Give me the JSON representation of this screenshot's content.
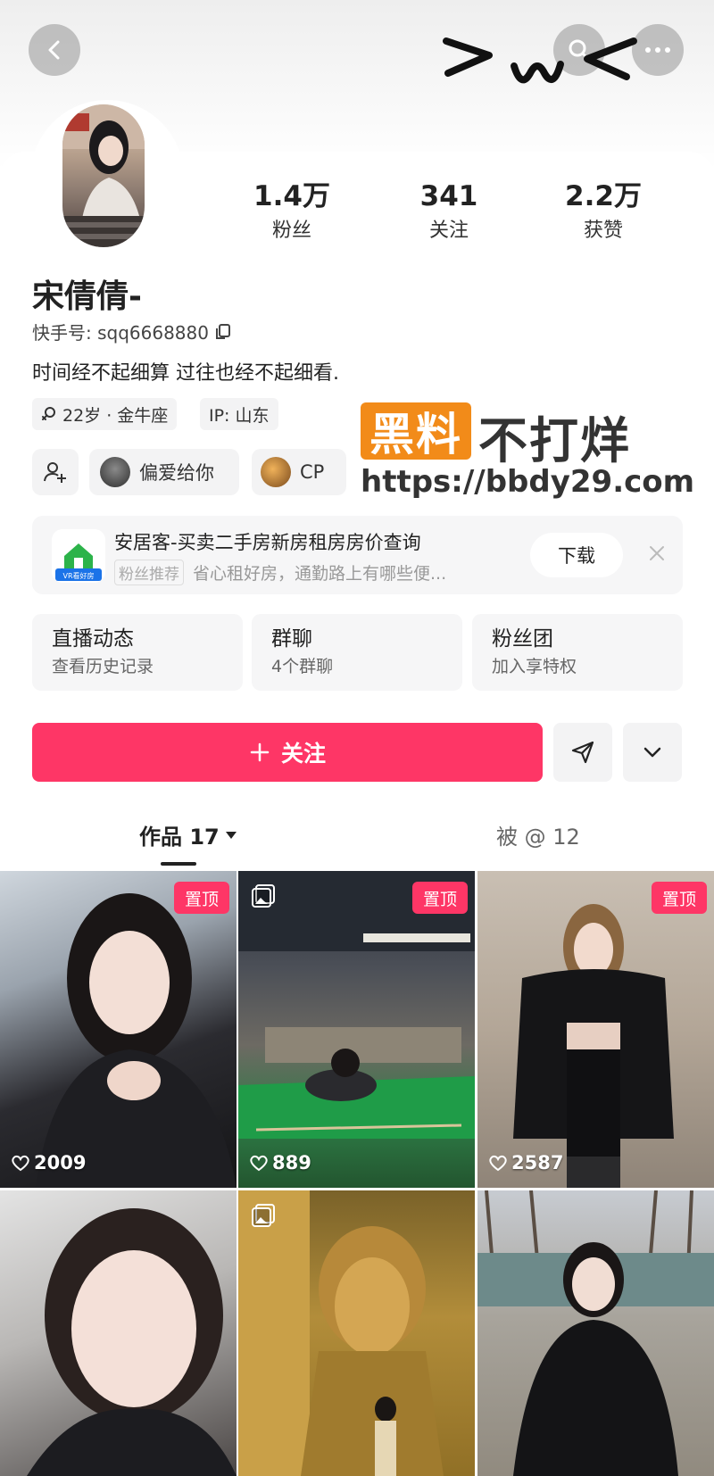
{
  "header": {
    "scribble_text": ">ω<"
  },
  "profile": {
    "username": "宋倩倩-",
    "kuaishou_id": "快手号: sqq6668880",
    "bio": "时间经不起细算 过往也经不起细看.",
    "stats": [
      {
        "value": "1.4万",
        "label": "粉丝"
      },
      {
        "value": "341",
        "label": "关注"
      },
      {
        "value": "2.2万",
        "label": "获赞"
      }
    ],
    "tags": {
      "age": "22岁 · 金牛座",
      "ip": "IP: 山东"
    },
    "relations": {
      "pian_ai": "偏爱给你",
      "cp": "CP"
    }
  },
  "watermark": {
    "badge": "黑料",
    "text": "不打烊",
    "url": "https://bbdy29.com"
  },
  "ad": {
    "title": "安居客-买卖二手房新房租房房价查询",
    "tag": "粉丝推荐",
    "subtitle": "省心租好房，通勤路上有哪些便...",
    "download": "下载",
    "icon_label": "VR看好房"
  },
  "features": [
    {
      "title": "直播动态",
      "sub": "查看历史记录"
    },
    {
      "title": "群聊",
      "sub": "4个群聊"
    },
    {
      "title": "粉丝团",
      "sub": "加入享特权"
    }
  ],
  "actions": {
    "follow": "关注"
  },
  "tabs": {
    "works": "作品 17",
    "mentioned": "被 @ 12"
  },
  "grid": [
    {
      "pinned": "置顶",
      "likes": "2009"
    },
    {
      "pinned": "置顶",
      "likes": "889"
    },
    {
      "pinned": "置顶",
      "likes": "2587"
    },
    {
      "pinned": "",
      "likes": ""
    },
    {
      "pinned": "",
      "likes": ""
    },
    {
      "pinned": "",
      "likes": ""
    }
  ],
  "colors": {
    "accent": "#fe3666",
    "watermark_orange": "#f28b19"
  }
}
